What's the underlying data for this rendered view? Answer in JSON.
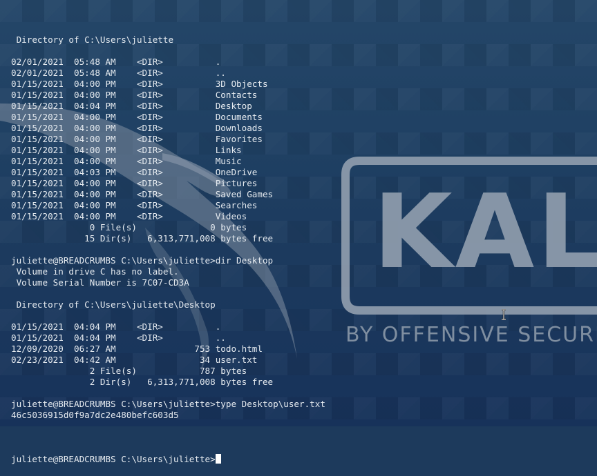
{
  "wallpaper": {
    "brand": "KALI",
    "tagline": "BY OFFENSIVE SECURITY",
    "colors": {
      "background": "#1d3a5c",
      "logo": "#8c9aab"
    }
  },
  "terminal": {
    "lines": [
      " Directory of C:\\Users\\juliette",
      "",
      "02/01/2021  05:48 AM    <DIR>          .",
      "02/01/2021  05:48 AM    <DIR>          ..",
      "01/15/2021  04:00 PM    <DIR>          3D Objects",
      "01/15/2021  04:00 PM    <DIR>          Contacts",
      "01/15/2021  04:04 PM    <DIR>          Desktop",
      "01/15/2021  04:00 PM    <DIR>          Documents",
      "01/15/2021  04:00 PM    <DIR>          Downloads",
      "01/15/2021  04:00 PM    <DIR>          Favorites",
      "01/15/2021  04:00 PM    <DIR>          Links",
      "01/15/2021  04:00 PM    <DIR>          Music",
      "01/15/2021  04:03 PM    <DIR>          OneDrive",
      "01/15/2021  04:00 PM    <DIR>          Pictures",
      "01/15/2021  04:00 PM    <DIR>          Saved Games",
      "01/15/2021  04:00 PM    <DIR>          Searches",
      "01/15/2021  04:00 PM    <DIR>          Videos",
      "               0 File(s)              0 bytes",
      "              15 Dir(s)   6,313,771,008 bytes free",
      "",
      "juliette@BREADCRUMBS C:\\Users\\juliette>dir Desktop",
      " Volume in drive C has no label.",
      " Volume Serial Number is 7C07-CD3A",
      "",
      " Directory of C:\\Users\\juliette\\Desktop",
      "",
      "01/15/2021  04:04 PM    <DIR>          .",
      "01/15/2021  04:04 PM    <DIR>          ..",
      "12/09/2020  06:27 AM               753 todo.html",
      "02/23/2021  04:42 AM                34 user.txt",
      "               2 File(s)            787 bytes",
      "               2 Dir(s)   6,313,771,008 bytes free",
      "",
      "juliette@BREADCRUMBS C:\\Users\\juliette>type Desktop\\user.txt",
      "46c5036915d0f9a7dc2e480befc603d5",
      ""
    ],
    "prompt": "juliette@BREADCRUMBS C:\\Users\\juliette>",
    "input_value": "",
    "colors": {
      "text": "#e6ebf0",
      "cursor": "#ffffff"
    }
  }
}
